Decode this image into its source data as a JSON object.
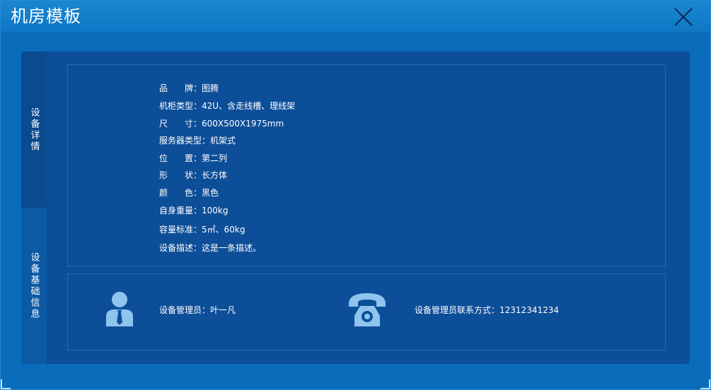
{
  "window": {
    "title": "机房模板",
    "close_icon": "close-icon"
  },
  "tabs": [
    {
      "label": "设备详情",
      "active": true
    },
    {
      "label": "设备基础信息",
      "active": false
    }
  ],
  "details": [
    {
      "label": "品　　牌：",
      "value": "图腾"
    },
    {
      "label": "机柜类型：",
      "value": "42U、含走线槽、理线架"
    },
    {
      "label": "尺　　寸：",
      "value": "600X500X1975mm"
    },
    {
      "label": "服务器类型：",
      "value": "机架式"
    },
    {
      "label": "位　　置：",
      "value": "第二列"
    },
    {
      "label": "形　　状：",
      "value": "长方体"
    },
    {
      "label": "颜　　色：",
      "value": "黑色"
    },
    {
      "label": "自身重量：",
      "value": "100kg"
    },
    {
      "label": "容量标准：",
      "value": "5㎡、60kg"
    },
    {
      "label": "设备描述：",
      "value": "这是一条描述。"
    }
  ],
  "contact": {
    "admin_label": "设备管理员：",
    "admin_value": "叶一凡",
    "phone_label": "设备管理员联系方式：",
    "phone_value": "12312341234"
  },
  "colors": {
    "background": "#0a6cba",
    "titlebar": "#1a85d0",
    "panel": "#0d4e98",
    "icon": "#8ec4ee"
  }
}
